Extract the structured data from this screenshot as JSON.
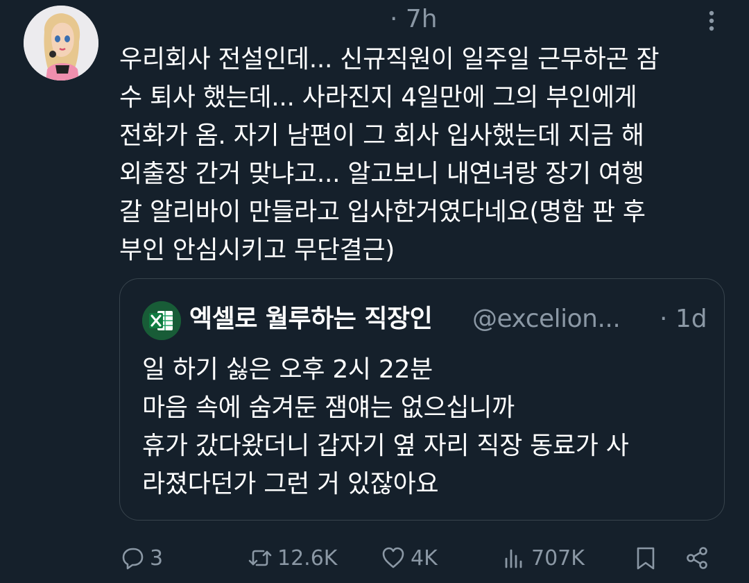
{
  "tweet": {
    "time": "· 7h",
    "text": "우리회사 전설인데... 신규직원이 일주일 근무하곤 잠\n수 퇴사 했는데... 사라진지 4일만에 그의 부인에게\n전화가 옴. 자기 남편이 그 회사 입사했는데 지금 해\n외출장 간거 맞냐고... 알고보니 내연녀랑 장기 여행\n갈 알리바이 만들라고 입사한거였다네요(명함 판 후\n부인 안심시키고 무단결근)",
    "avatar_icon": "doll-avatar-icon",
    "more_icon": "more-vertical-icon"
  },
  "quoted": {
    "name": "엑셀로 월루하는 직장인",
    "handle": "@excelion...",
    "time": "· 1d",
    "logo_icon": "excel-icon",
    "text": "일 하기 싫은 오후 2시 22분\n마음 속에 숨겨둔 잼얘는 없으십니까\n휴가 갔다왔더니 갑자기 옆 자리 직장 동료가 사\n라졌다던가 그런 거 있잖아요"
  },
  "actions": {
    "reply_count": "3",
    "retweet_count": "12.6K",
    "like_count": "4K",
    "views_count": "707K"
  },
  "colors": {
    "background": "#15202b",
    "secondary_text": "#8b98a5",
    "border": "#38444d",
    "excel_green": "#185c37"
  }
}
